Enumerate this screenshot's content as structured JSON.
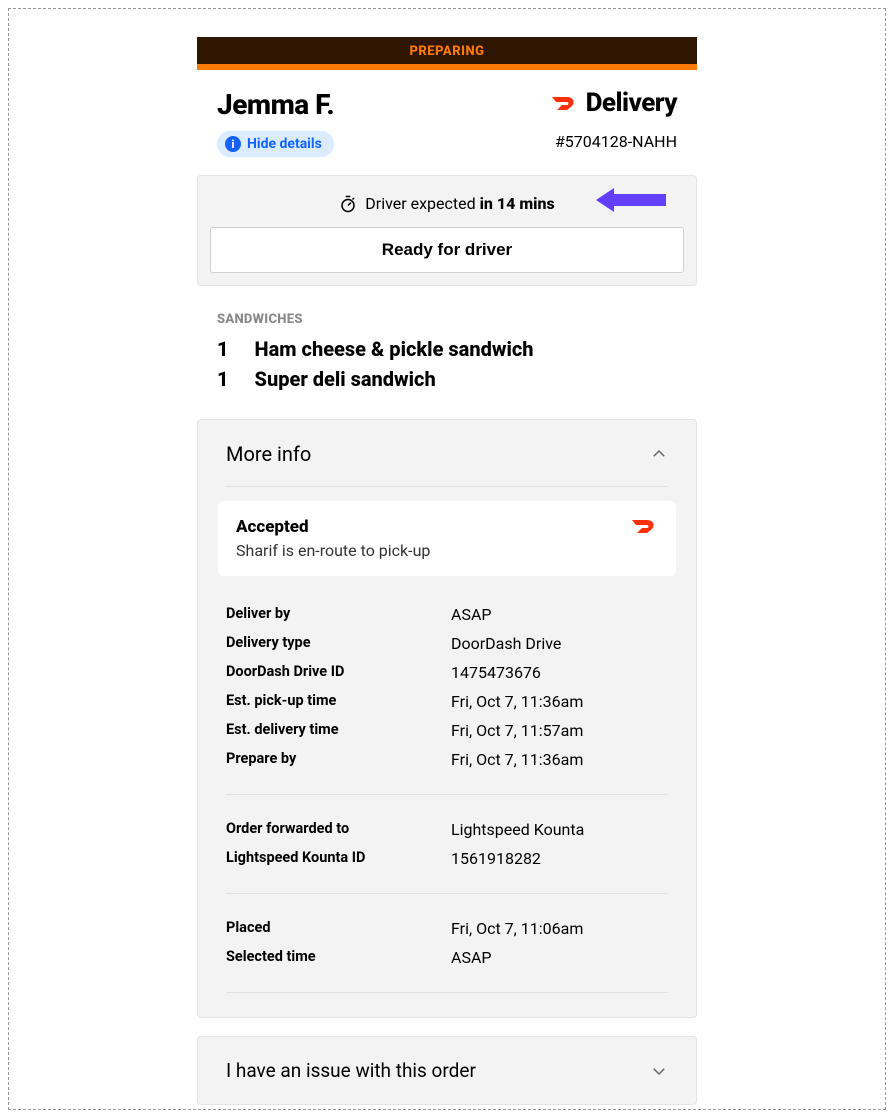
{
  "status_label": "PREPARING",
  "customer_name": "Jemma F.",
  "hide_details_label": "Hide details",
  "delivery_label": "Delivery",
  "order_number": "#5704128-NAHH",
  "eta": {
    "prefix": "Driver expected ",
    "bold": "in 14 mins"
  },
  "ready_for_driver_label": "Ready for driver",
  "category_label": "SANDWICHES",
  "items": [
    {
      "qty": "1",
      "name": "Ham cheese & pickle sandwich"
    },
    {
      "qty": "1",
      "name": "Super deli sandwich"
    }
  ],
  "more_info_label": "More info",
  "accepted": {
    "title": "Accepted",
    "subtitle": "Sharif is en-route to pick-up"
  },
  "info_group1": [
    {
      "label": "Deliver by",
      "value": "ASAP"
    },
    {
      "label": "Delivery type",
      "value": "DoorDash Drive"
    },
    {
      "label": "DoorDash Drive ID",
      "value": "1475473676"
    },
    {
      "label": "Est. pick-up time",
      "value": "Fri, Oct 7, 11:36am"
    },
    {
      "label": "Est. delivery time",
      "value": "Fri, Oct 7, 11:57am"
    },
    {
      "label": "Prepare by",
      "value": "Fri, Oct 7, 11:36am"
    }
  ],
  "info_group2": [
    {
      "label": "Order forwarded to",
      "value": "Lightspeed Kounta"
    },
    {
      "label": "Lightspeed Kounta ID",
      "value": "1561918282"
    }
  ],
  "info_group3": [
    {
      "label": "Placed",
      "value": "Fri, Oct 7, 11:06am"
    },
    {
      "label": "Selected time",
      "value": "ASAP"
    }
  ],
  "issue_label": "I have an issue with this order"
}
